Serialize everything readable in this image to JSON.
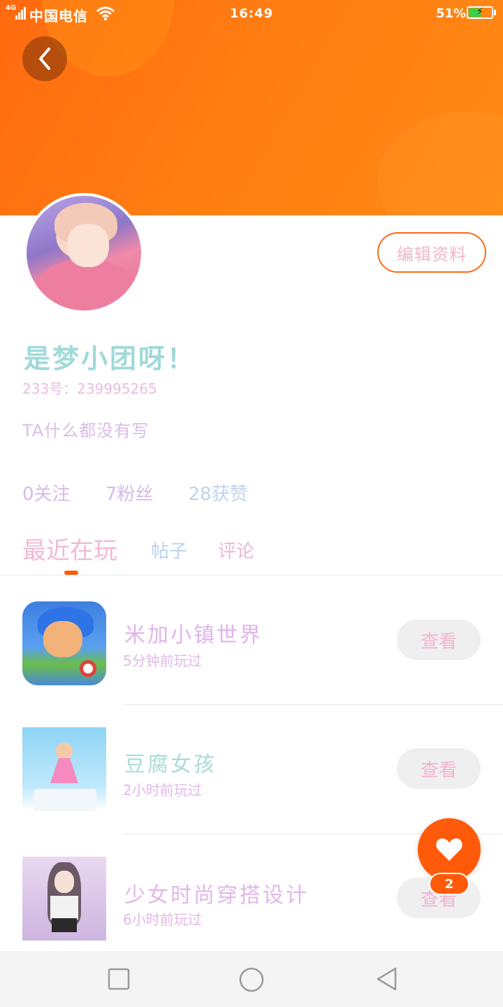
{
  "status_bar": {
    "network": "4G",
    "carrier": "中国电信",
    "time": "16:49",
    "battery_percent": "51%",
    "battery_level": 0.51,
    "battery_color": "#3ad04a"
  },
  "header": {
    "back_icon": "chevron-left-icon",
    "accent_color": "#ff6a10"
  },
  "profile": {
    "edit_label": "编辑资料",
    "nickname": "是梦小团呀！",
    "uid": "233号：239995265",
    "bio": "TA什么都没有写",
    "stats": {
      "following": "0关注",
      "followers": "7粉丝",
      "likes": "28获赞"
    }
  },
  "tabs": [
    {
      "label": "最近在玩",
      "active": true
    },
    {
      "label": "帖子",
      "active": false
    },
    {
      "label": "评论",
      "active": false
    }
  ],
  "games": [
    {
      "title": "米加小镇世界",
      "played": "5分钟前玩过",
      "action": "查看"
    },
    {
      "title": "豆腐女孩",
      "played": "2小时前玩过",
      "action": "查看"
    },
    {
      "title": "少女时尚穿搭设计",
      "played": "6小时前玩过",
      "action": "查看"
    }
  ],
  "floating": {
    "icon": "heart-icon",
    "badge": "2"
  },
  "nav": {
    "recents_icon": "square-icon",
    "home_icon": "circle-icon",
    "back_icon": "triangle-back-icon"
  }
}
